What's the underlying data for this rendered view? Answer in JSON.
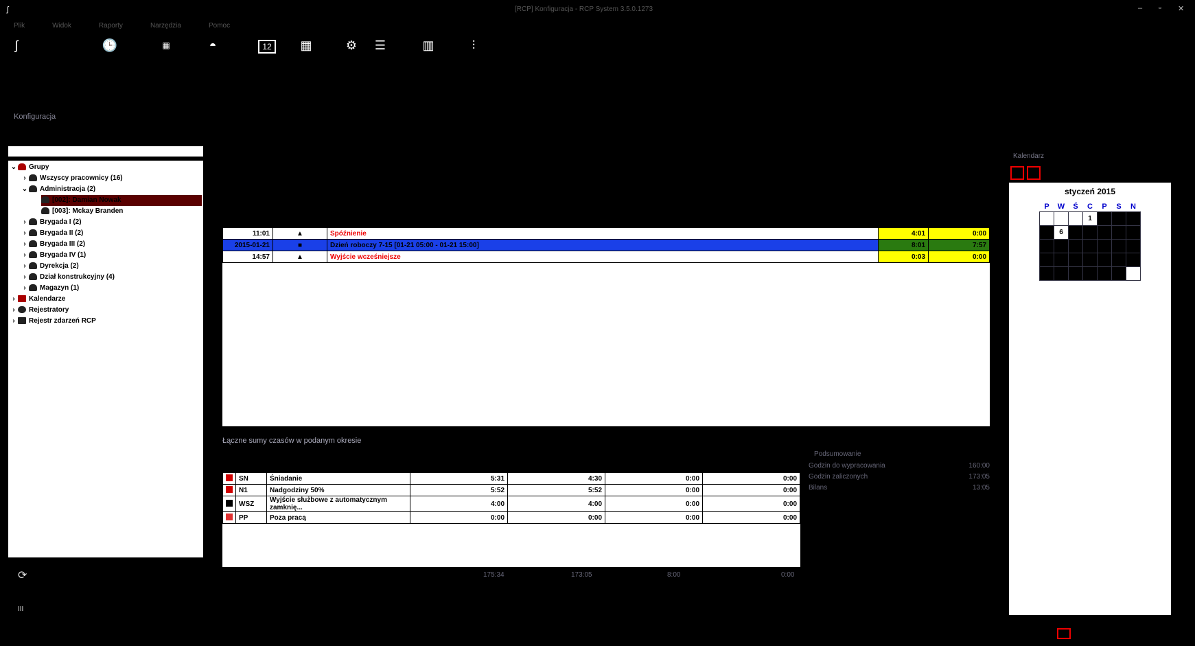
{
  "titlebar": {
    "title": "[RCP] Konfiguracja - RCP System 3.5.0.1273"
  },
  "menu": {
    "items": [
      "Plik",
      "Widok",
      "Raporty",
      "Narzędzia",
      "Pomoc"
    ]
  },
  "left": {
    "title_label": "Konfiguracja",
    "search_placeholder": ""
  },
  "tree": {
    "groups_label": "Grupy",
    "items": [
      {
        "label": "Wszyscy pracownicy (16)"
      },
      {
        "label": "Administracja (2)"
      },
      {
        "label": "[002]: Damian Nowak"
      },
      {
        "label": "[003]: Mckay Branden"
      },
      {
        "label": "Brygada I (2)"
      },
      {
        "label": "Brygada II (2)"
      },
      {
        "label": "Brygada III (2)"
      },
      {
        "label": "Brygada IV (1)"
      },
      {
        "label": "Dyrekcja (2)"
      },
      {
        "label": "Dział konstrukcyjny (4)"
      },
      {
        "label": "Magazyn (1)"
      }
    ],
    "roots": [
      "Kalendarze",
      "Rejestratory",
      "Rejestr zdarzeń RCP"
    ]
  },
  "events": {
    "rows": [
      {
        "time": "11:01",
        "label": "Spóźnienie",
        "v1": "4:01",
        "v2": "0:00"
      },
      {
        "time": "2015-01-21",
        "label": "Dzień roboczy 7-15 [01-21 05:00 - 01-21 15:00]",
        "v1": "8:01",
        "v2": "7:57"
      },
      {
        "time": "14:57",
        "label": "Wyjście wcześniejsze",
        "v1": "0:03",
        "v2": "0:00"
      }
    ]
  },
  "sums": {
    "title": "Łączne sumy czasów w podanym okresie",
    "rows": [
      {
        "code": "SN",
        "name": "Śniadanie",
        "a": "5:31",
        "b": "4:30",
        "c": "0:00",
        "d": "0:00",
        "color": "#d00000"
      },
      {
        "code": "N1",
        "name": "Nadgodziny 50%",
        "a": "5:52",
        "b": "5:52",
        "c": "0:00",
        "d": "0:00",
        "color": "#d00000"
      },
      {
        "code": "WSZ",
        "name": "Wyjście służbowe z automatycznym zamknię...",
        "a": "4:00",
        "b": "4:00",
        "c": "0:00",
        "d": "0:00",
        "color": "#000000"
      },
      {
        "code": "PP",
        "name": "Poza pracą",
        "a": "0:00",
        "b": "0:00",
        "c": "0:00",
        "d": "0:00",
        "color": "#e03030"
      }
    ],
    "totals": [
      "175:34",
      "173:05",
      "8:00",
      "0:00"
    ]
  },
  "summary": {
    "title": "Podsumowanie",
    "rows": [
      {
        "label": "Godzin do wypracowania",
        "value": "160:00"
      },
      {
        "label": "Godzin zaliczonych",
        "value": "173:05"
      },
      {
        "label": "Bilans",
        "value": "13:05"
      }
    ]
  },
  "calendar": {
    "title": "Kalendarz",
    "month": "styczeń 2015",
    "weekdays": [
      "P",
      "W",
      "Ś",
      "C",
      "P",
      "S",
      "N"
    ],
    "day1": "1",
    "day6": "6"
  }
}
